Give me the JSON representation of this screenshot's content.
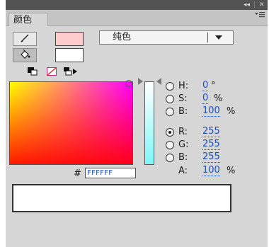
{
  "panel": {
    "title_controls": {
      "collapse": "◂◂",
      "close": "✕"
    },
    "tab_label": "颜色",
    "tab_menu_icon": "panel-menu-icon"
  },
  "tools": {
    "stroke_tool_icon": "pencil-icon",
    "fill_tool_icon": "paint-bucket-icon",
    "stroke_color": "#ffcccc",
    "fill_color": "#ffffff",
    "mini_icons": [
      "black-white-icon",
      "no-color-icon",
      "swap-colors-icon"
    ]
  },
  "fill_type": {
    "selected": "纯色"
  },
  "color": {
    "field_gradient": [
      "#ffff00",
      "#ff00ff",
      "#ff0000"
    ],
    "hue_bar_colors": [
      "#ffffff",
      "#7df7f7"
    ],
    "hex_label": "#",
    "hex_value": "FFFFFF"
  },
  "params": {
    "H": {
      "key": "H:",
      "value": "0",
      "unit": "°",
      "checked": false
    },
    "S": {
      "key": "S:",
      "value": "0",
      "unit": "%",
      "checked": false
    },
    "Bv": {
      "key": "B:",
      "value": "100",
      "unit": "%",
      "checked": false
    },
    "R": {
      "key": "R:",
      "value": "255",
      "unit": "",
      "checked": true
    },
    "G": {
      "key": "G:",
      "value": "255",
      "unit": "",
      "checked": false
    },
    "Bc": {
      "key": "B:",
      "value": "255",
      "unit": "",
      "checked": false
    },
    "A": {
      "key": "A:",
      "value": "100",
      "unit": "%"
    }
  },
  "preview": {
    "color": "#ffffff"
  }
}
